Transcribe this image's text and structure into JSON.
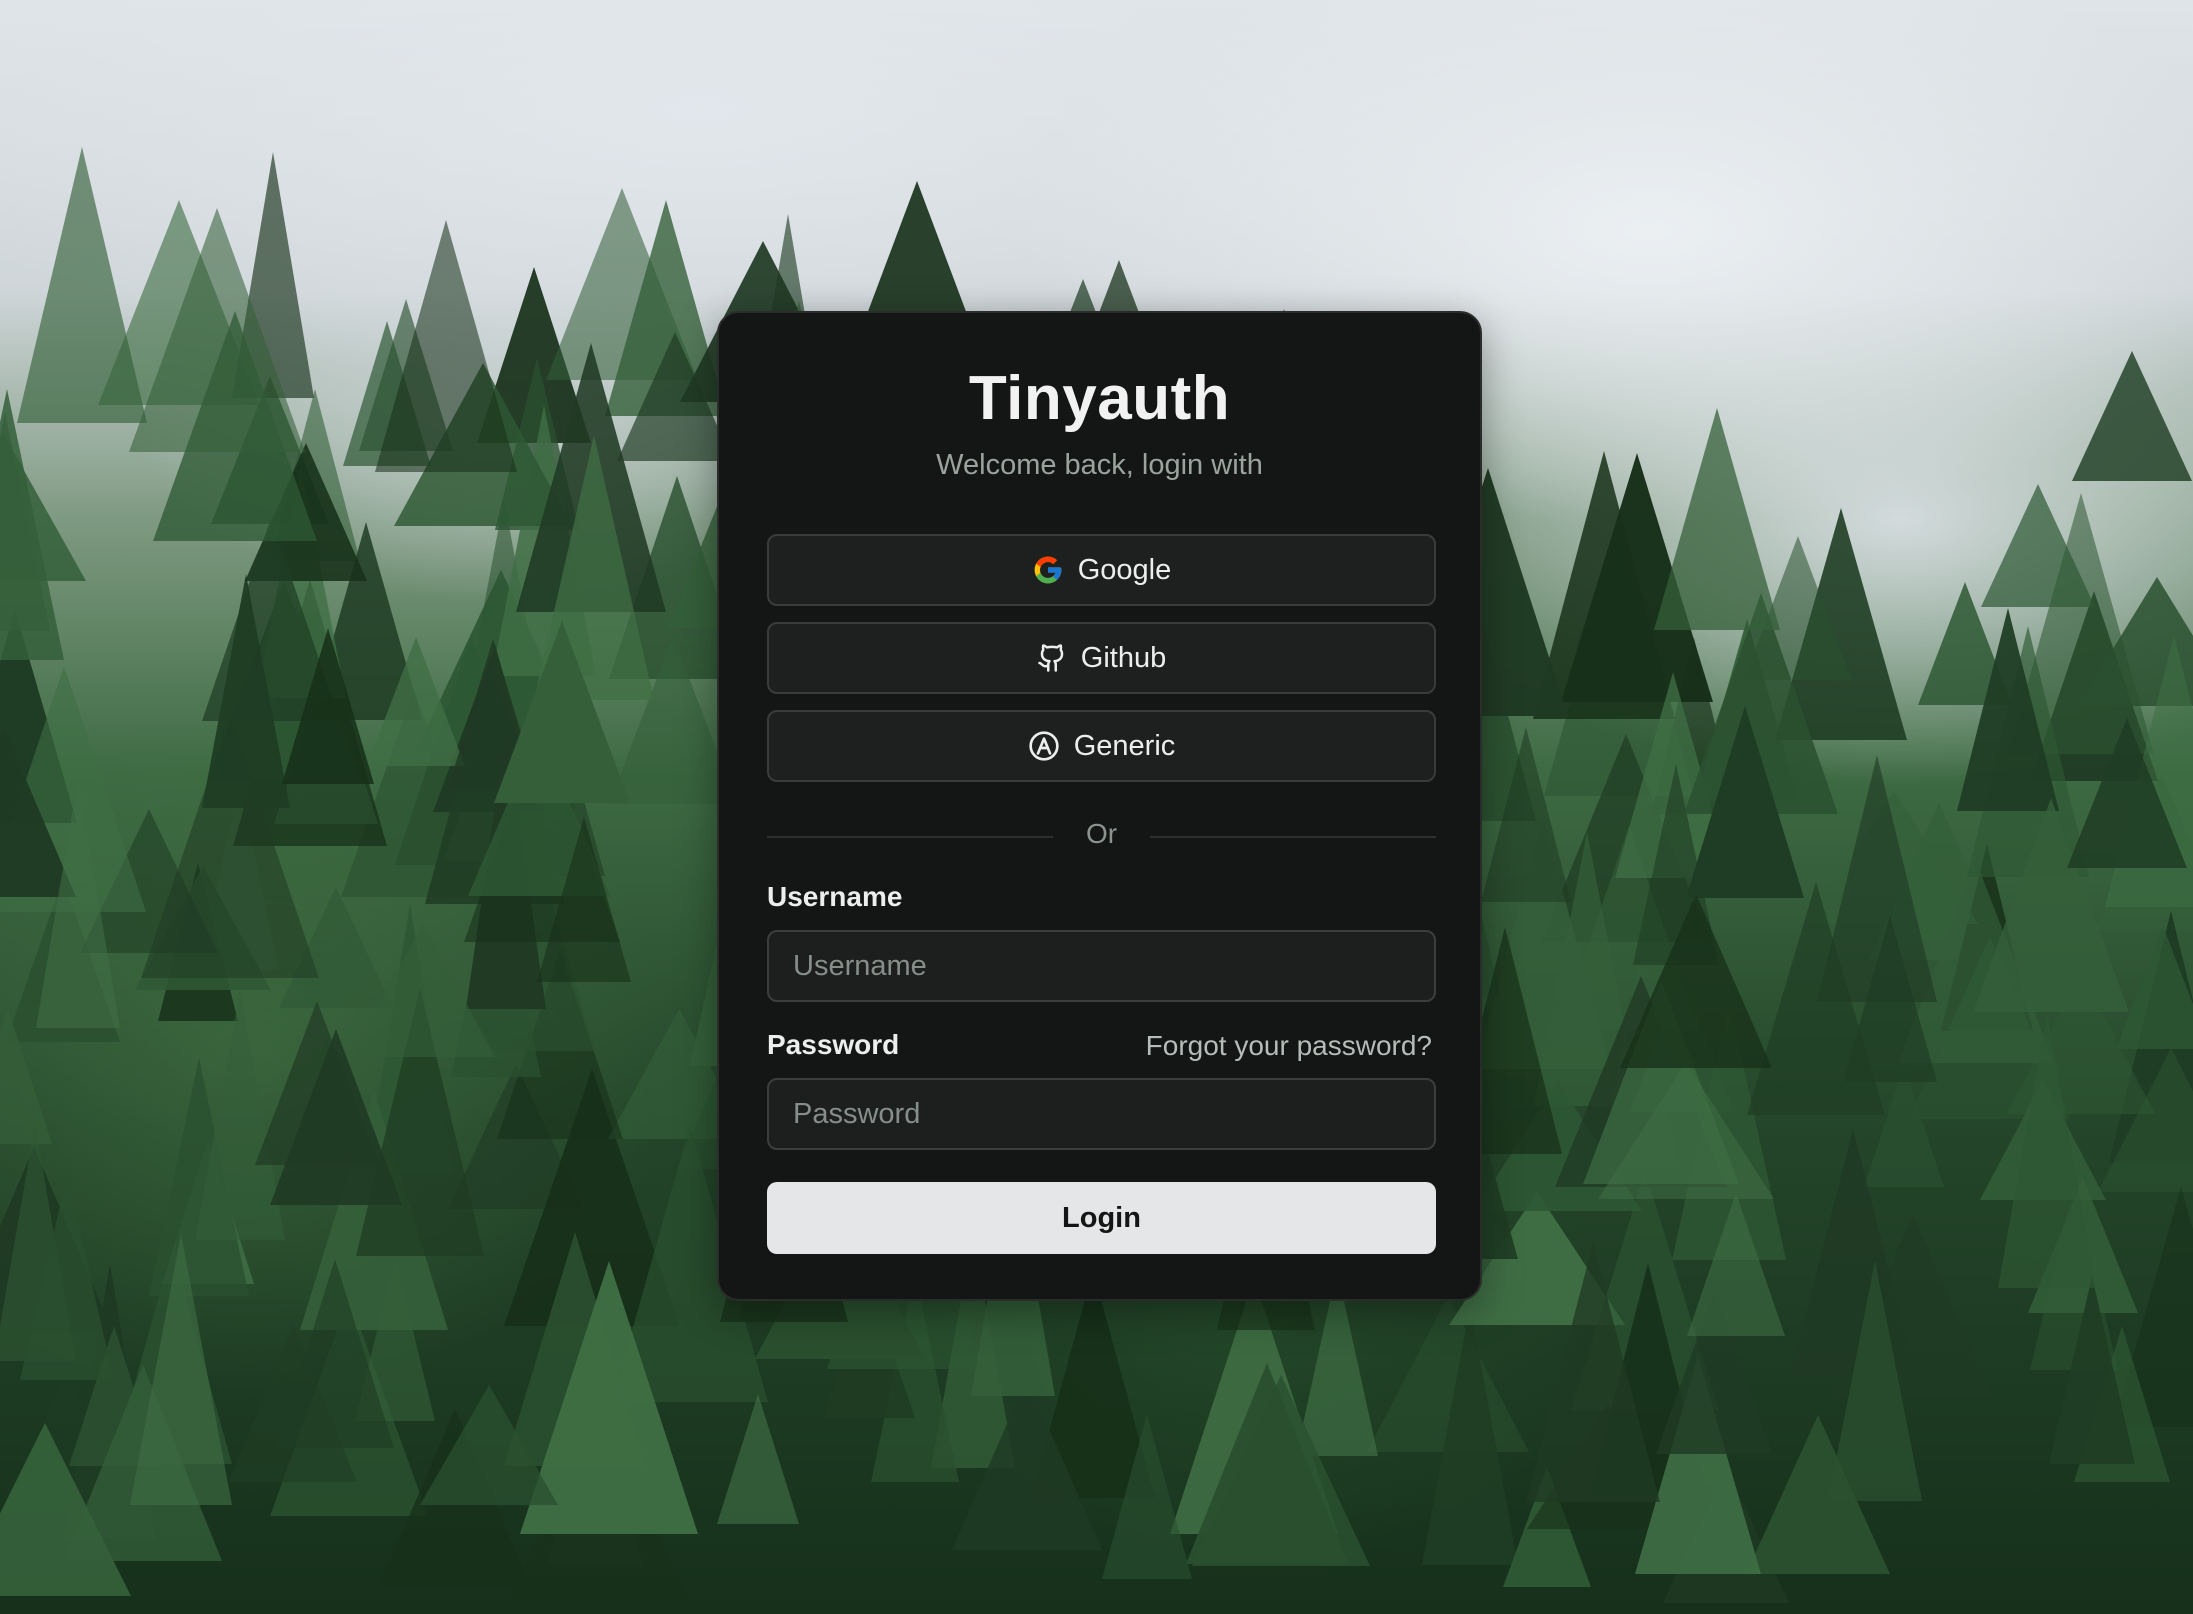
{
  "app": {
    "title": "Tinyauth",
    "subtitle": "Welcome back, login with"
  },
  "oauth": {
    "providers": [
      {
        "label": "Google",
        "icon": "google-icon"
      },
      {
        "label": "Github",
        "icon": "github-icon"
      },
      {
        "label": "Generic",
        "icon": "generic-oauth-icon"
      }
    ]
  },
  "divider": {
    "label": "Or"
  },
  "form": {
    "username_label": "Username",
    "username_placeholder": "Username",
    "username_value": "",
    "password_label": "Password",
    "password_placeholder": "Password",
    "password_value": "",
    "forgot_label": "Forgot your password?",
    "login_label": "Login"
  },
  "theme": {
    "card_bg": "#141615",
    "button_bg": "#1e201f",
    "login_bg": "#e4e6e7",
    "text": "#eceeed",
    "muted": "#9aa39d"
  }
}
